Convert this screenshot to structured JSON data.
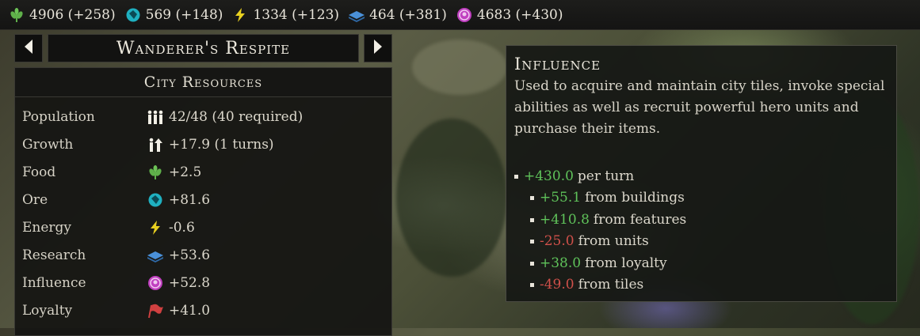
{
  "topbar": {
    "resources": [
      {
        "icon": "food-wheat-icon",
        "value": "4906 (+258)",
        "color": "#5fb04a"
      },
      {
        "icon": "ore-crystal-icon",
        "value": "569 (+148)",
        "color": "#1fb0c0"
      },
      {
        "icon": "energy-bolt-icon",
        "value": "1334 (+123)",
        "color": "#e8d020"
      },
      {
        "icon": "research-book-icon",
        "value": "464 (+381)",
        "color": "#4a90d8"
      },
      {
        "icon": "influence-icon",
        "value": "4683 (+430)",
        "color": "#c040c0"
      }
    ]
  },
  "city": {
    "name": "Wanderer's Respite",
    "prev_icon": "arrow-left-icon",
    "next_icon": "arrow-right-icon"
  },
  "panel": {
    "title": "City Resources",
    "rows": [
      {
        "label": "Population",
        "icon": "population-icon",
        "value": "42/48 (40 required)",
        "tone": "normal"
      },
      {
        "label": "Growth",
        "icon": "growth-icon",
        "value": "+17.9 (1 turns)",
        "tone": "normal"
      },
      {
        "label": "Food",
        "icon": "food-wheat-icon",
        "value": "+2.5",
        "tone": "normal"
      },
      {
        "label": "Ore",
        "icon": "ore-crystal-icon",
        "value": "+81.6",
        "tone": "normal"
      },
      {
        "label": "Energy",
        "icon": "energy-bolt-icon",
        "value": "-0.6",
        "tone": "negative"
      },
      {
        "label": "Research",
        "icon": "research-book-icon",
        "value": "+53.6",
        "tone": "normal"
      },
      {
        "label": "Influence",
        "icon": "influence-icon",
        "value": "+52.8",
        "tone": "normal"
      },
      {
        "label": "Loyalty",
        "icon": "loyalty-flag-icon",
        "value": "+41.0",
        "tone": "normal"
      }
    ]
  },
  "tooltip": {
    "title": "Influence",
    "description": "Used to acquire and maintain city tiles, invoke special abilities as well as recruit powerful hero units and purchase their items.",
    "per_turn": {
      "num": "+430.0",
      "text": "per turn"
    },
    "sources": [
      {
        "num": "+55.1",
        "text": "from buildings",
        "tone": "positive"
      },
      {
        "num": "+410.8",
        "text": "from features",
        "tone": "positive"
      },
      {
        "num": "-25.0",
        "text": "from units",
        "tone": "negative"
      },
      {
        "num": "+38.0",
        "text": "from loyalty",
        "tone": "positive"
      },
      {
        "num": "-49.0",
        "text": "from tiles",
        "tone": "negative"
      }
    ]
  }
}
